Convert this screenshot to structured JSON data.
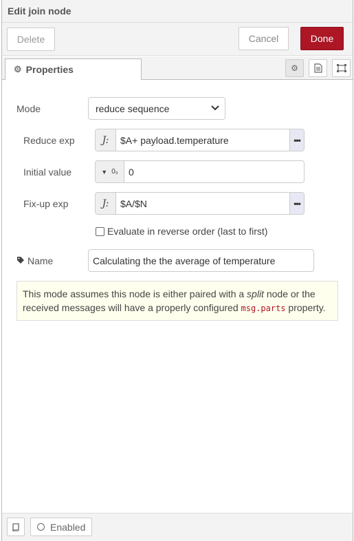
{
  "header": {
    "title": "Edit join node"
  },
  "buttons": {
    "delete": "Delete",
    "cancel": "Cancel",
    "done": "Done"
  },
  "tabs": {
    "properties": "Properties"
  },
  "form": {
    "mode_label": "Mode",
    "mode_value": "reduce sequence",
    "reduce_label": "Reduce exp",
    "reduce_type": "J:",
    "reduce_value": "$A+ payload.temperature",
    "initial_label": "Initial value",
    "initial_type": "0₉",
    "initial_value": "0",
    "fixup_label": "Fix-up exp",
    "fixup_type": "J:",
    "fixup_value": "$A/$N",
    "reverse_label": "Evaluate in reverse order (last to first)",
    "reverse_checked": false,
    "name_label": "Name",
    "name_value": "Calculating the  the average of temperature"
  },
  "tip": {
    "part1": "This mode assumes this node is either paired with a ",
    "italic": "split",
    "part2": " node or the received messages will have a properly configured ",
    "code": "msg.parts",
    "part3": " property."
  },
  "footer": {
    "enabled_label": "Enabled"
  },
  "colors": {
    "done": "#ad1625",
    "tip_bg": "#ffffee",
    "code": "#ad1625"
  },
  "icons": [
    "gear-icon",
    "description-icon",
    "appearance-icon",
    "tag-icon",
    "book-icon",
    "chevron-down-icon",
    "expand-icon",
    "caret-down-icon"
  ]
}
